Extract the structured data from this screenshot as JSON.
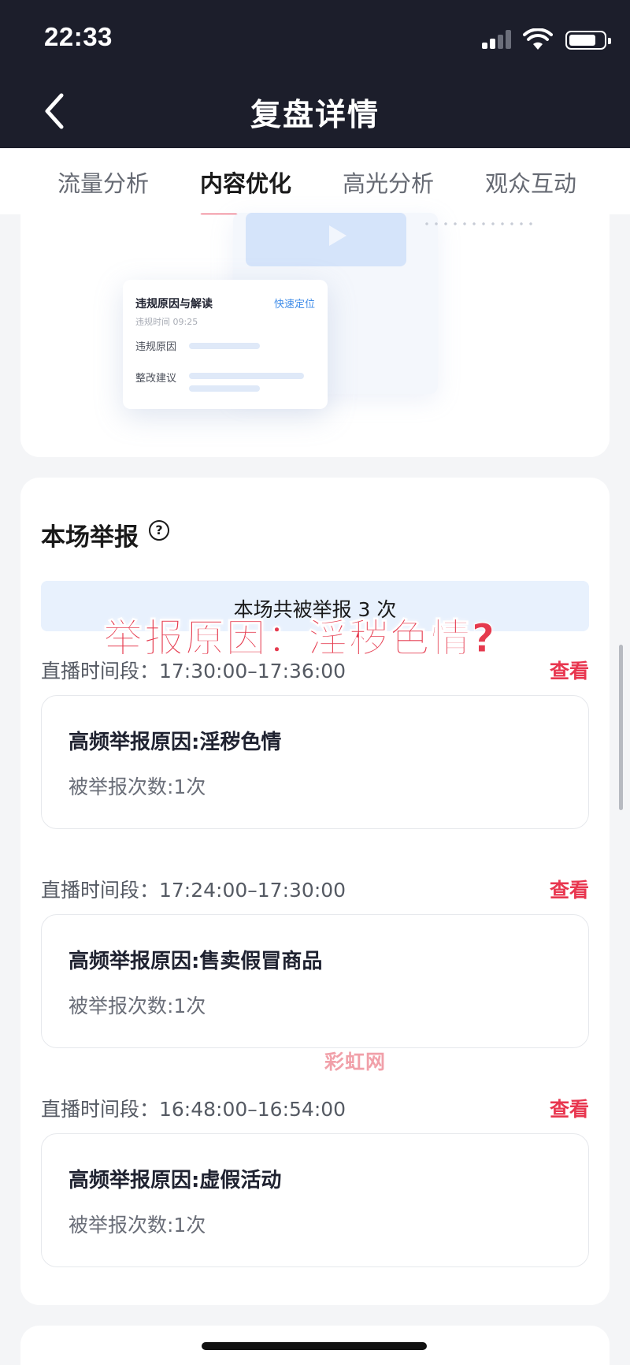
{
  "status_bar": {
    "time": "22:33",
    "signal": "signal-icon",
    "wifi": "wifi-icon",
    "battery_level": 0.8
  },
  "header": {
    "title": "复盘详情",
    "back_icon": "chevron-left-icon"
  },
  "tabs": [
    {
      "label": "流量分析",
      "active": false
    },
    {
      "label": "内容优化",
      "active": true
    },
    {
      "label": "高光分析",
      "active": false
    },
    {
      "label": "观众互动",
      "active": false
    }
  ],
  "illustration": {
    "panel_title": "违规原因与解读",
    "panel_link": "快速定位",
    "panel_time": "违规时间 09:25",
    "row1_label": "违规原因",
    "row2_label": "整改建议"
  },
  "report": {
    "title": "本场举报",
    "help_icon": "question-circle-icon",
    "summary": "本场共被举报 3 次",
    "overlay_caption": "举报原因：淫秽色情?",
    "view_label": "查看",
    "slots": [
      {
        "time": "直播时间段：17:30:00–17:36:00",
        "reason": "高频举报原因:淫秽色情",
        "count": "被举报次数:1次"
      },
      {
        "time": "直播时间段：17:24:00–17:30:00",
        "reason": "高频举报原因:售卖假冒商品",
        "count": "被举报次数:1次"
      },
      {
        "time": "直播时间段：16:48:00–16:54:00",
        "reason": "高频举报原因:虚假活动",
        "count": "被举报次数:1次"
      }
    ],
    "watermark": "彩虹网"
  },
  "colors": {
    "header_bg": "#1c1e2b",
    "accent": "#e8364f",
    "summary_bg": "#e8f1fd",
    "page_bg": "#f4f5f7"
  }
}
